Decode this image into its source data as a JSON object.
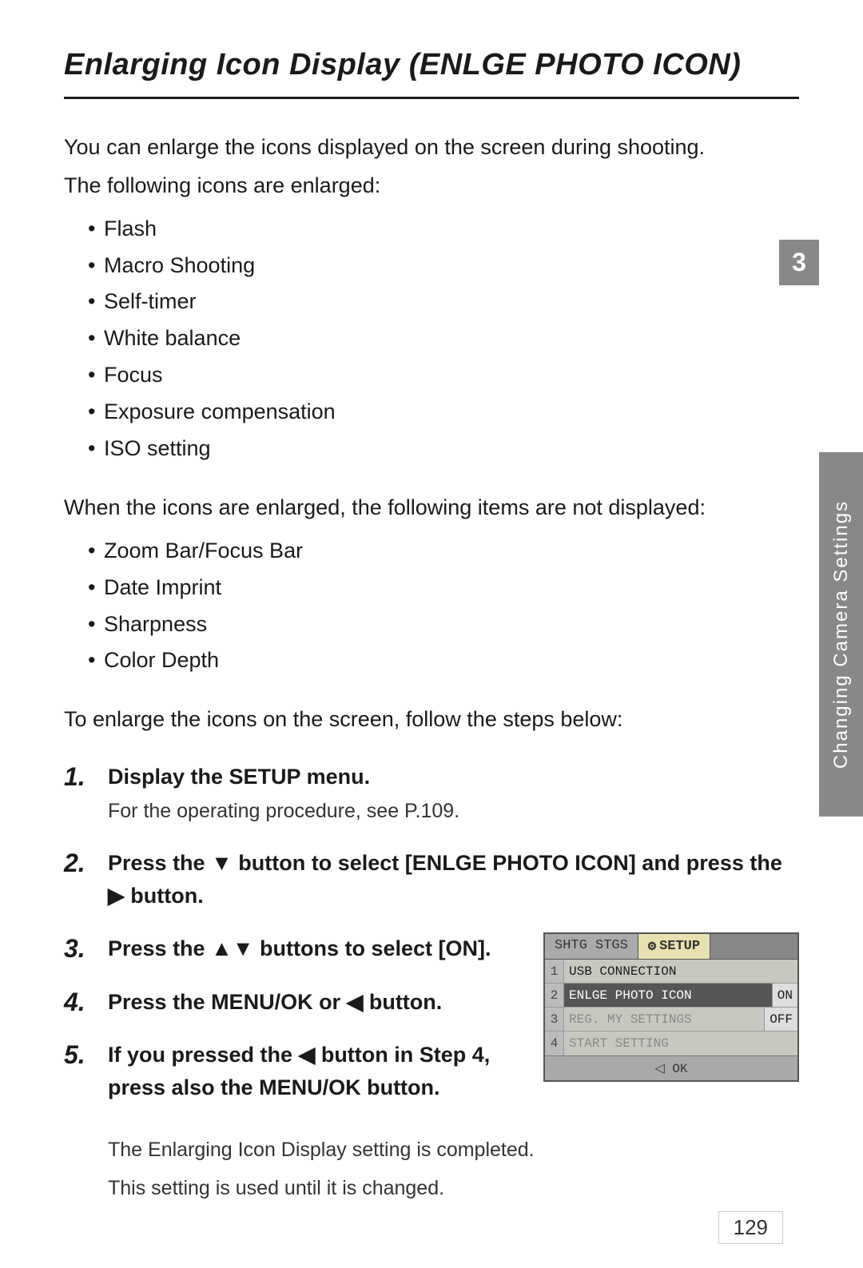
{
  "page": {
    "title": "Enlarging Icon Display (ENLGE PHOTO ICON)",
    "intro": {
      "line1": "You can enlarge the icons displayed on the screen during shooting.",
      "line2": "The following icons are enlarged:"
    },
    "enlarged_icons": [
      "Flash",
      "Macro Shooting",
      "Self-timer",
      "White balance",
      "Focus",
      "Exposure compensation",
      "ISO setting"
    ],
    "not_displayed_intro": "When the icons are enlarged, the following items are not displayed:",
    "not_displayed_items": [
      "Zoom Bar/Focus Bar",
      "Date Imprint",
      "Sharpness",
      "Color Depth"
    ],
    "steps_intro": "To enlarge the icons on the screen, follow the steps below:",
    "steps": [
      {
        "number": "1.",
        "title": "Display the SETUP menu.",
        "sub": "For the operating procedure, see P.109."
      },
      {
        "number": "2.",
        "title": "Press the ▼ button to select [ENLGE PHOTO ICON] and press the ▶ button."
      },
      {
        "number": "3.",
        "title": "Press the ▲▼ buttons to select [ON]."
      },
      {
        "number": "4.",
        "title": "Press the MENU/OK  or ◀ button."
      },
      {
        "number": "5.",
        "title": "If you pressed the ◀ button in Step 4, press also the MENU/OK button."
      }
    ],
    "after_step5": [
      "The Enlarging Icon Display setting is completed.",
      "This setting is used until it is changed."
    ],
    "screen": {
      "tab1": "SHTG STGS",
      "tab2": "⚙ SETUP",
      "rows": [
        {
          "num": "1",
          "label": "USB CONNECTION",
          "value": "",
          "highlighted": false,
          "grayed": false
        },
        {
          "num": "2",
          "label": "ENLGE PHOTO ICON",
          "value": "ON",
          "highlighted": true,
          "grayed": false
        },
        {
          "num": "3",
          "label": "REG. MY SETTINGS",
          "value": "OFF",
          "highlighted": false,
          "grayed": true
        },
        {
          "num": "4",
          "label": "START SETTING",
          "value": "",
          "highlighted": false,
          "grayed": true
        }
      ],
      "footer": "◁ OK"
    },
    "sidebar": {
      "number": "3",
      "label": "Changing Camera Settings"
    },
    "page_number": "129"
  }
}
